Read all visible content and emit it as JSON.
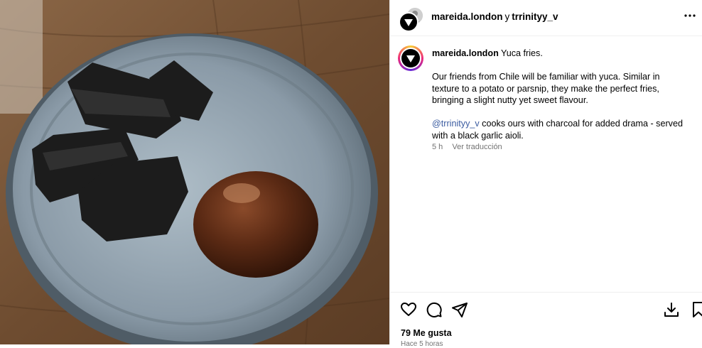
{
  "header": {
    "user1": "mareida.london",
    "conjunction": "y",
    "user2": "trrinityy_v"
  },
  "caption": {
    "username": "mareida.london",
    "title": "Yuca fries.",
    "paragraph1": "Our friends from Chile will be familiar with yuca. Similar in texture to a potato or parsnip, they make the perfect fries, bringing a slight nutty yet sweet flavour.",
    "mention": "@trrinityy_v",
    "paragraph2_rest": " cooks ours with charcoal for added drama - served with a black garlic aioli.",
    "time": "5 h",
    "translate": "Ver traducción"
  },
  "footer": {
    "likes": "79 Me gusta",
    "timeago": "Hace 5 horas"
  },
  "icons": {
    "like": "heart-icon",
    "comment": "comment-icon",
    "share": "send-icon",
    "download": "download-icon",
    "save": "bookmark-icon",
    "more": "more-options-icon"
  }
}
